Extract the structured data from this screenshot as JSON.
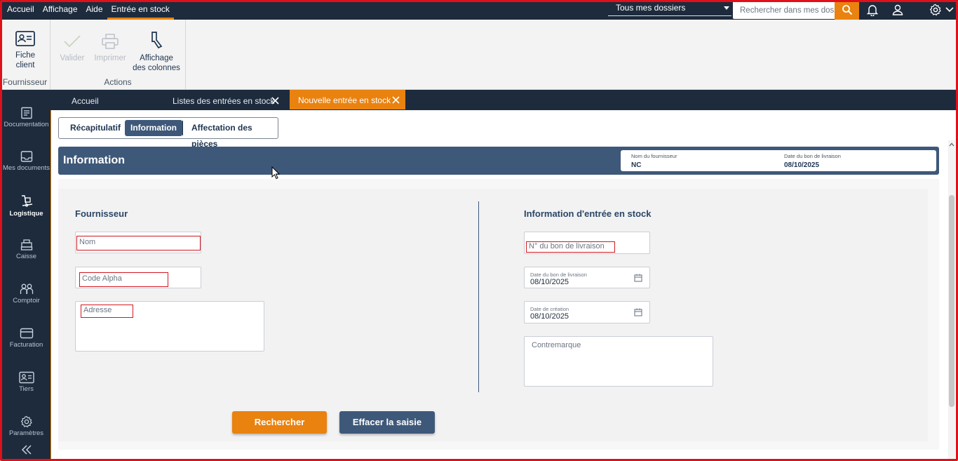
{
  "menu": {
    "items": [
      "Accueil",
      "Affichage",
      "Aide",
      "Entrée en stock"
    ],
    "active_index": 3
  },
  "header": {
    "folder_select": "Tous mes dossiers",
    "search_placeholder": "Rechercher dans mes dossiers",
    "icons": [
      "search-icon",
      "bell-icon",
      "user-icon",
      "gear-icon",
      "chevron-down-icon"
    ]
  },
  "ribbon": {
    "fournisseur_group": {
      "label": "Fournisseur",
      "fiche_line1": "Fiche",
      "fiche_line2": "client"
    },
    "actions_group": {
      "label": "Actions",
      "valider": "Valider",
      "imprimer": "Imprimer",
      "affichage_line1": "Affichage",
      "affichage_line2": "des colonnes"
    }
  },
  "sidenav": {
    "items": [
      {
        "label": "Documentation",
        "icon": "document-icon"
      },
      {
        "label": "Mes documents",
        "icon": "inbox-icon"
      },
      {
        "label": "Logistique",
        "icon": "logistics-icon",
        "active": true
      },
      {
        "label": "Caisse",
        "icon": "cash-register-icon"
      },
      {
        "label": "Comptoir",
        "icon": "people-icon"
      },
      {
        "label": "Facturation",
        "icon": "credit-card-icon"
      },
      {
        "label": "Tiers",
        "icon": "contact-card-icon"
      },
      {
        "label": "Paramètres",
        "icon": "gear-icon"
      }
    ],
    "collapse_icon": "double-chevron-left-icon"
  },
  "tabs": [
    {
      "label": "Accueil"
    },
    {
      "label": "Listes des entrées en stock",
      "closable": true
    },
    {
      "label": "Nouvelle entrée en stock",
      "closable": true,
      "active": true
    }
  ],
  "segments": {
    "items": [
      "Récapitulatif",
      "Information",
      "Affectation des pièces"
    ],
    "active_index": 1
  },
  "banner": {
    "title": "Information",
    "supplier_name_label": "Nom du fournisseur",
    "supplier_name_value": "NC",
    "delivery_date_label": "Date du bon de livraison",
    "delivery_date_value": "08/10/2025"
  },
  "fournisseur_section": {
    "title": "Fournisseur",
    "nom_placeholder": "Nom",
    "code_alpha_placeholder": "Code Alpha",
    "adresse_placeholder": "Adresse"
  },
  "stock_section": {
    "title": "Information d'entrée en stock",
    "bon_livraison_placeholder": "N° du bon de livraison",
    "date_bon_label": "Date du bon de livraison",
    "date_bon_value": "08/10/2025",
    "date_creation_label": "Date de création",
    "date_creation_value": "08/10/2025",
    "contremarque_placeholder": "Contremarque"
  },
  "buttons": {
    "rechercher": "Rechercher",
    "effacer": "Effacer la saisie"
  },
  "colors": {
    "navy": "#1d2b3d",
    "accent_orange": "#e9820f",
    "banner_blue": "#3e5879",
    "placeholder_highlight": "#d01820"
  }
}
